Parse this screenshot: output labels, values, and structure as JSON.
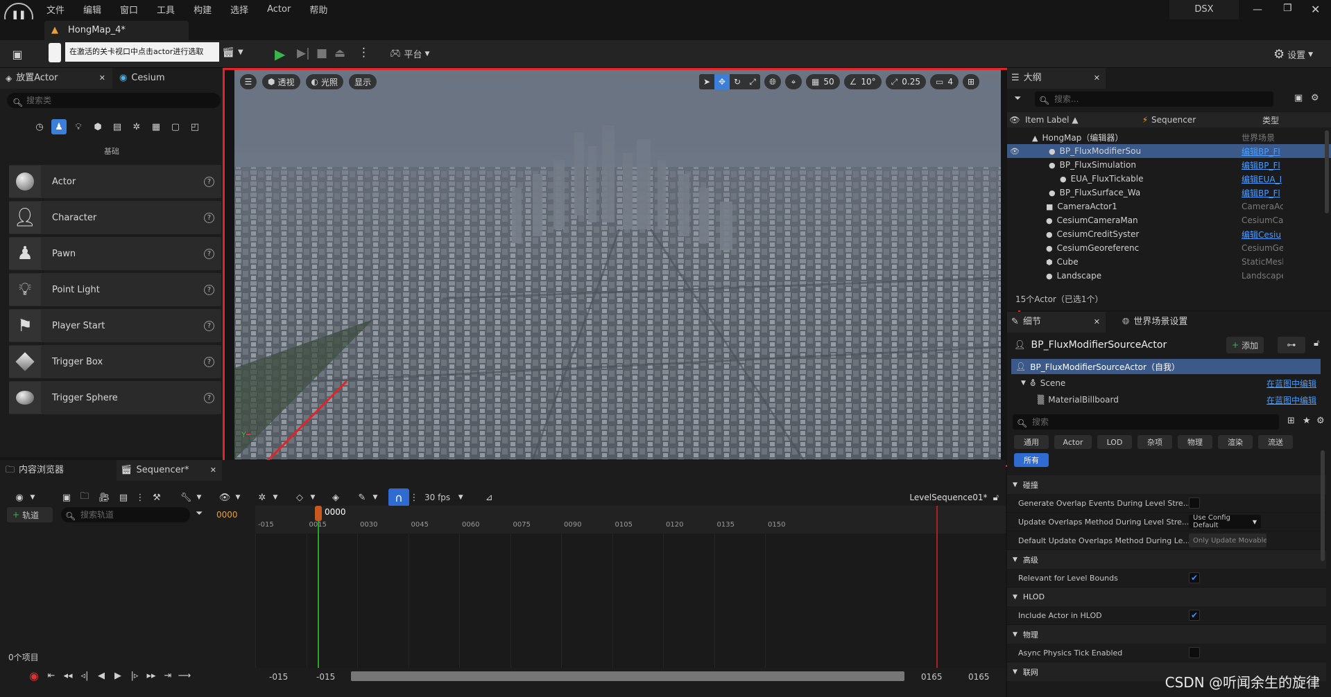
{
  "menu": [
    "文件",
    "编辑",
    "窗口",
    "工具",
    "构建",
    "选择",
    "Actor",
    "帮助"
  ],
  "user": "DSX",
  "doc_tab": "HongMap_4*",
  "tooltip": "在激活的关卡视口中点击actor进行选取",
  "toolbar": {
    "platform": "平台",
    "settings": "设置"
  },
  "place_actor": {
    "tab1": "放置Actor",
    "tab2": "Cesium",
    "search_placeholder": "搜索类",
    "category": "基础",
    "items": [
      "Actor",
      "Character",
      "Pawn",
      "Point Light",
      "Player Start",
      "Trigger Box",
      "Trigger Sphere"
    ]
  },
  "viewport": {
    "perspective": "透视",
    "lit": "光照",
    "show": "显示",
    "grid": "50",
    "angle": "10°",
    "scale": "0.25",
    "camera": "4"
  },
  "outliner": {
    "title": "大纲",
    "search_placeholder": "搜索...",
    "col_label": "Item Label ▲",
    "col_seq": "Sequencer",
    "col_type": "类型",
    "rows": [
      {
        "label": "HongMap（编辑器）",
        "type": "世界场景",
        "link": false
      },
      {
        "label": "BP_FluxModifierSou",
        "type": "编辑BP_Fl",
        "link": true
      },
      {
        "label": "BP_FluxSimulation",
        "type": "编辑BP_Fl",
        "link": true
      },
      {
        "label": "EUA_FluxTickable",
        "type": "编辑EUA_I",
        "link": true
      },
      {
        "label": "BP_FluxSurface_Wa",
        "type": "编辑BP_Fl",
        "link": true
      },
      {
        "label": "CameraActor1",
        "type": "CameraAc",
        "link": false
      },
      {
        "label": "CesiumCameraMan",
        "type": "CesiumCa",
        "link": false
      },
      {
        "label": "CesiumCreditSyster",
        "type": "编辑Cesiu",
        "link": true
      },
      {
        "label": "CesiumGeoreferenc",
        "type": "CesiumGe",
        "link": false
      },
      {
        "label": "Cube",
        "type": "StaticMesl",
        "link": false
      },
      {
        "label": "Landscape",
        "type": "Landscape",
        "link": false
      }
    ],
    "footer": "15个Actor（已选1个）"
  },
  "details": {
    "tab1": "细节",
    "tab2": "世界场景设置",
    "actor_name": "BP_FluxModifierSourceActor",
    "add": "添加",
    "self_row": "BP_FluxModifierSourceActor（自我）",
    "scene": "Scene",
    "scene_link": "在蓝图中编辑",
    "billboard": "MaterialBillboard",
    "billboard_link": "在蓝图中编辑",
    "search_placeholder": "搜索",
    "filters": [
      "通用",
      "Actor",
      "LOD",
      "杂项",
      "物理",
      "渲染",
      "流送"
    ],
    "filter_all": "所有",
    "cat_collision": "碰撞",
    "p1": "Generate Overlap Events During Level Stre...",
    "p2": "Update Overlaps Method During Level Stre...",
    "p2v": "Use Config Default",
    "p3": "Default Update Overlaps Method During Le...",
    "p3v": "Only Update Movable",
    "cat_advanced": "高级",
    "p4": "Relevant for Level Bounds",
    "cat_hlod": "HLOD",
    "p5": "Include Actor in HLOD",
    "cat_physics": "物理",
    "p6": "Async Physics Tick Enabled",
    "cat_net": "联网"
  },
  "sequencer": {
    "tab1": "内容浏览器",
    "tab2": "Sequencer*",
    "fps": "30 fps",
    "sequence_name": "LevelSequence01*",
    "add_track": "轨道",
    "search_placeholder": "搜索轨道",
    "frame": "0000",
    "playhead": "0000",
    "ticks": [
      "-015",
      "0015",
      "0030",
      "0045",
      "0060",
      "0075",
      "0090",
      "0105",
      "0120",
      "0135",
      "0150"
    ],
    "items_count": "0个项目",
    "range_start": "-015",
    "range_start2": "-015",
    "range_end": "0165",
    "range_end2": "0165"
  },
  "watermark": "CSDN @听闻余生的旋律"
}
